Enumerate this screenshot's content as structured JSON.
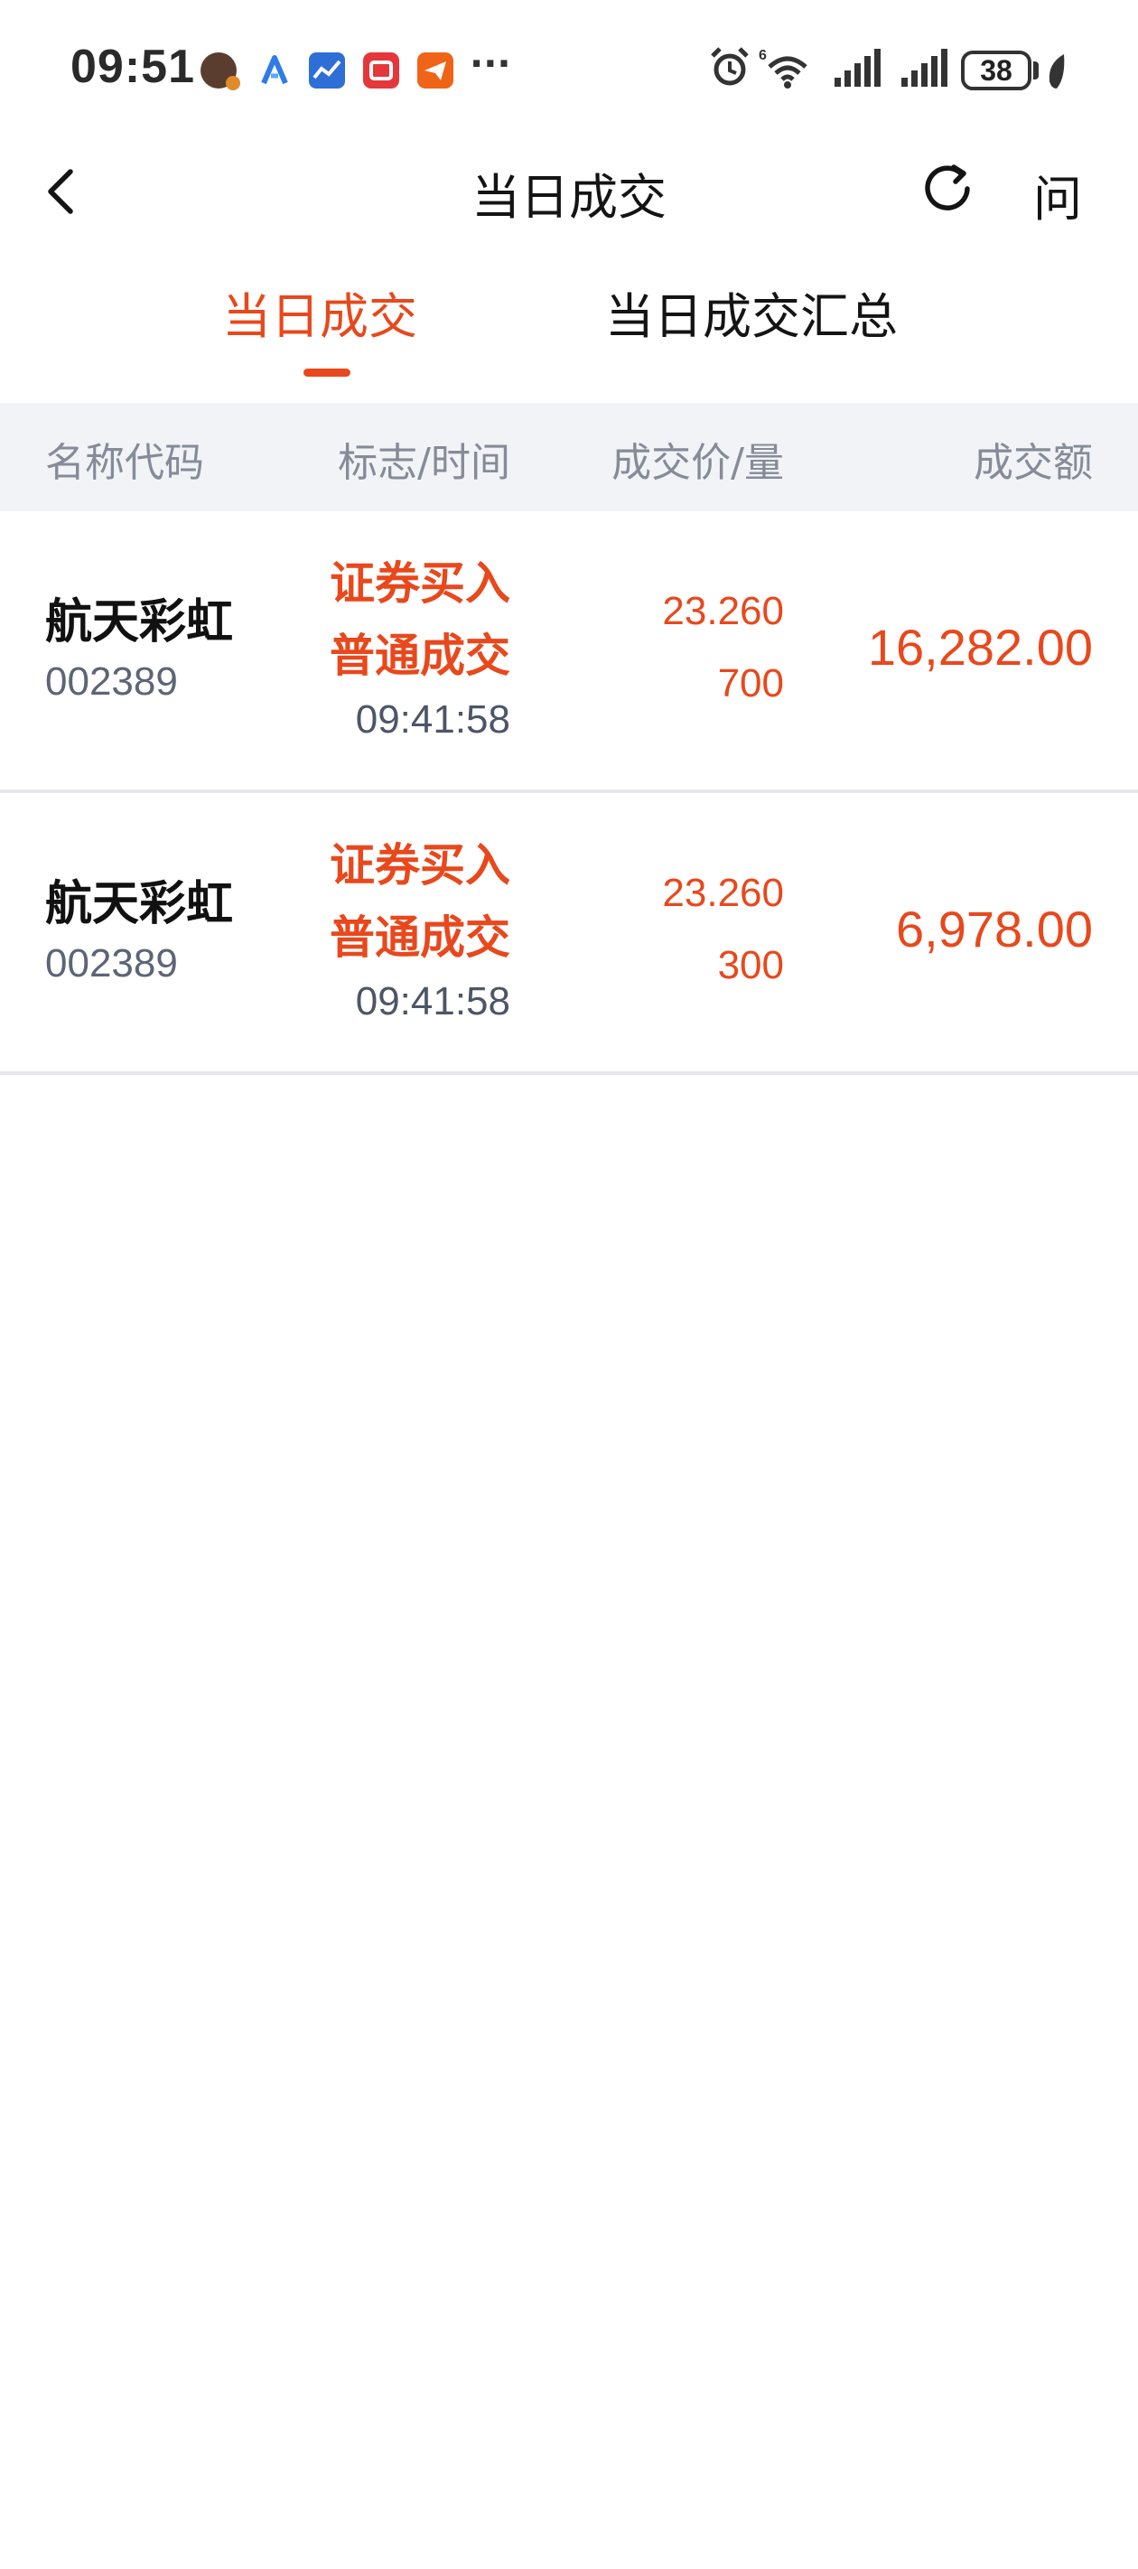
{
  "status_bar": {
    "time": "09:51",
    "more": "···",
    "battery": "38",
    "icons": [
      "avatar-icon",
      "a-logo-icon",
      "chart-app-icon",
      "book-app-icon",
      "plane-app-icon",
      "alarm-icon",
      "wifi-icon",
      "signal-icon",
      "signal-icon",
      "battery-icon",
      "leaf-icon"
    ]
  },
  "nav": {
    "title": "当日成交",
    "ask_label": "问"
  },
  "tabs": [
    {
      "label": "当日成交",
      "active": true
    },
    {
      "label": "当日成交汇总",
      "active": false
    }
  ],
  "table": {
    "headers": {
      "name": "名称代码",
      "flag_time": "标志/时间",
      "price_qty": "成交价/量",
      "amount": "成交额"
    },
    "rows": [
      {
        "name": "航天彩虹",
        "code": "002389",
        "flag1": "证券买入",
        "flag2": "普通成交",
        "time": "09:41:58",
        "price": "23.260",
        "qty": "700",
        "amount": "16,282.00"
      },
      {
        "name": "航天彩虹",
        "code": "002389",
        "flag1": "证券买入",
        "flag2": "普通成交",
        "time": "09:41:58",
        "price": "23.260",
        "qty": "300",
        "amount": "6,978.00"
      }
    ]
  },
  "colors": {
    "accent": "#e8481c",
    "header_bg": "#f1f3f7",
    "muted_text": "#858b97"
  }
}
